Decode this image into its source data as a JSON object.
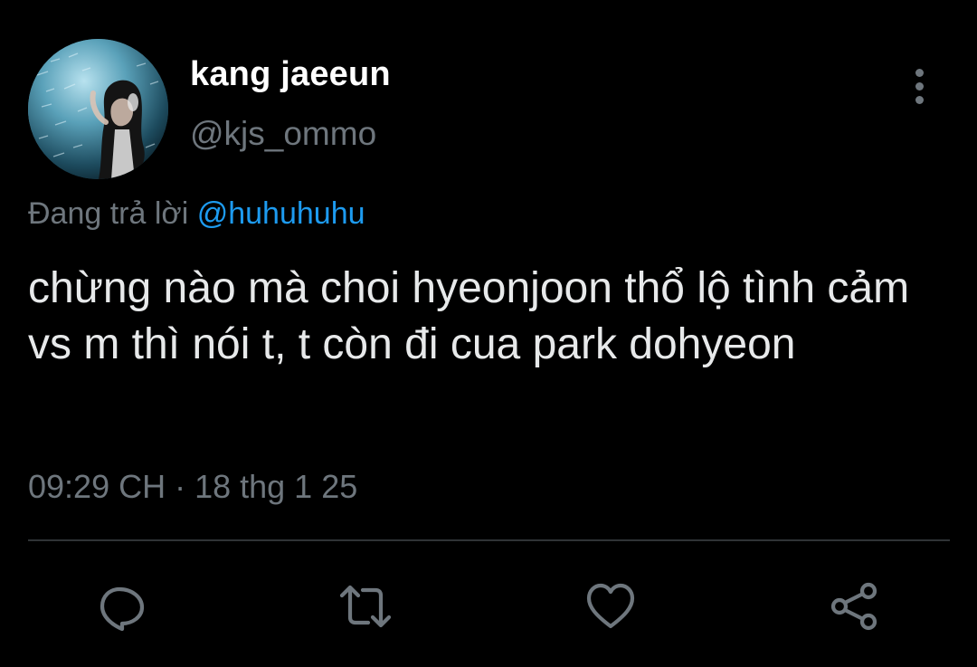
{
  "author": {
    "display_name": "kang jaeeun",
    "handle": "@kjs_ommo"
  },
  "reply": {
    "prefix": "Đang trả lời",
    "mention": "@huhuhuhu"
  },
  "tweet": {
    "text": "chừng nào mà choi hyeonjoon thổ lộ tình cảm vs m thì nói t, t còn đi cua park dohyeon",
    "timestamp": "09:29 CH · 18 thg 1 25"
  },
  "icons": {
    "more": "more-vertical-icon",
    "reply": "reply-icon",
    "retweet": "retweet-icon",
    "like": "heart-icon",
    "share": "share-icon"
  },
  "colors": {
    "background": "#000000",
    "text": "#e7e9ea",
    "secondary": "#6e767d",
    "accent": "#1d9bf0",
    "divider": "#2f3336"
  }
}
